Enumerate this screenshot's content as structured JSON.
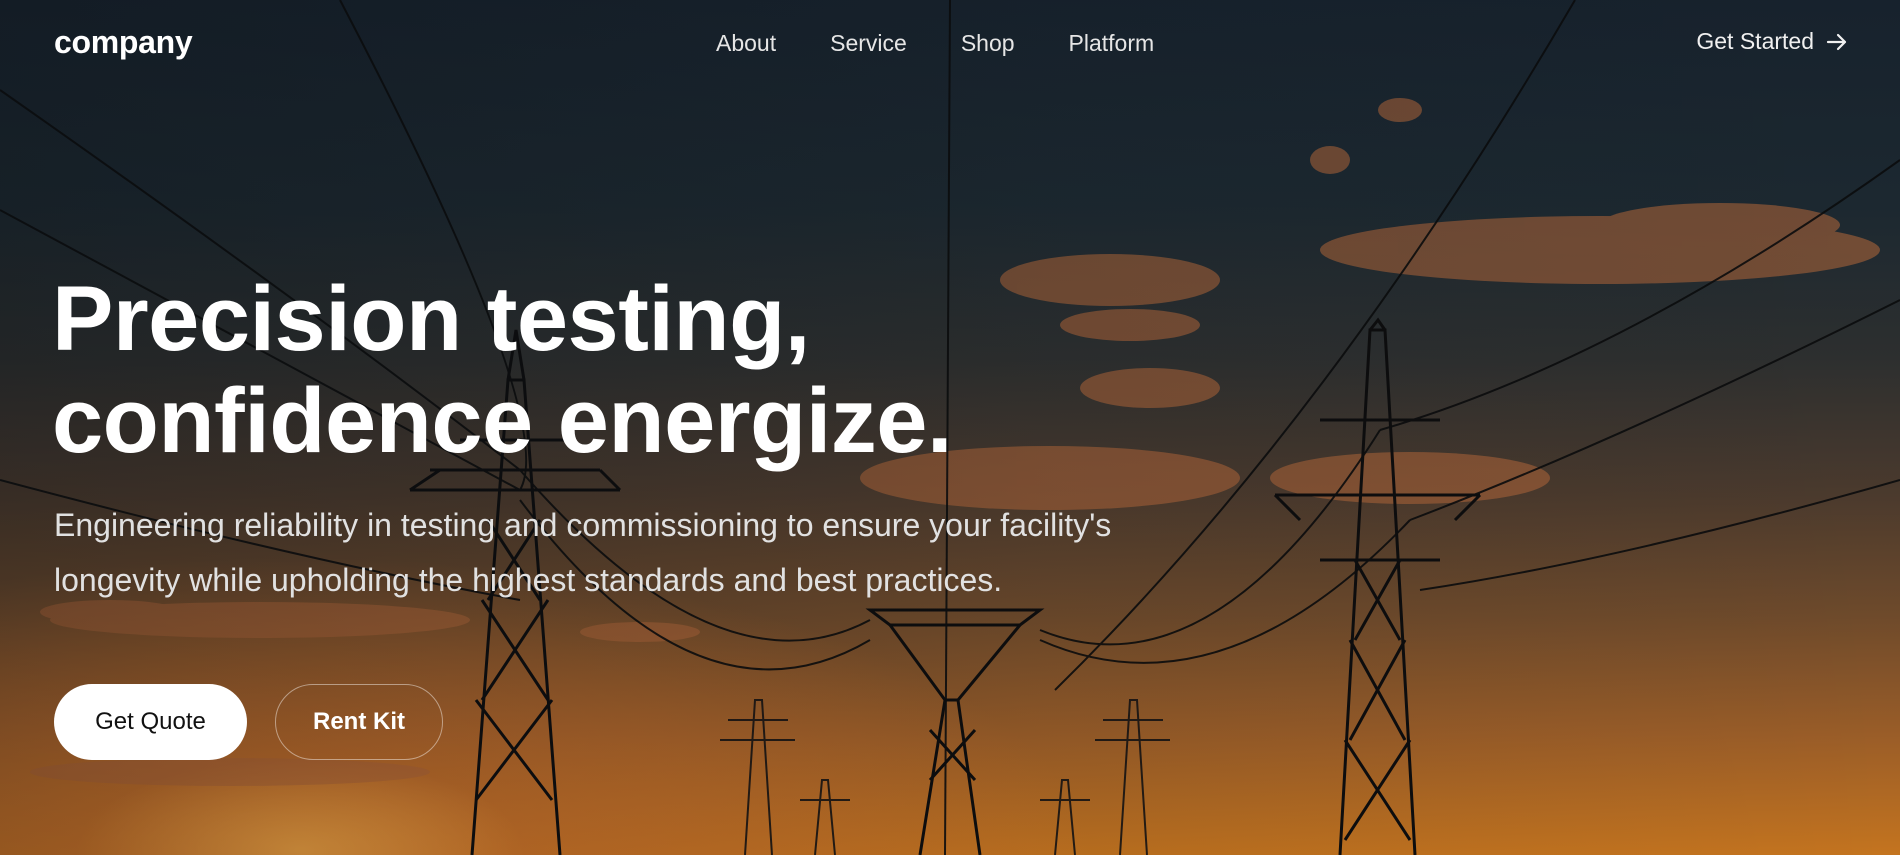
{
  "brand": {
    "logo_text": "company"
  },
  "nav": {
    "items": [
      {
        "label": "About"
      },
      {
        "label": "Service"
      },
      {
        "label": "Shop"
      },
      {
        "label": "Platform"
      }
    ],
    "cta_label": "Get Started",
    "cta_icon": "arrow-right-icon"
  },
  "hero": {
    "headline_line1": "Precision testing,",
    "headline_line2": "confidence energize.",
    "subtext_line1": "Engineering reliability in testing and commissioning to ensure your facility's",
    "subtext_line2": "longevity while upholding the highest standards and best practices.",
    "primary_button": "Get Quote",
    "secondary_button": "Rent Kit"
  },
  "colors": {
    "sky_top": "#17222d",
    "sunset_glow": "#c4741f",
    "primary_button_bg": "#ffffff",
    "primary_button_text": "#111111"
  }
}
